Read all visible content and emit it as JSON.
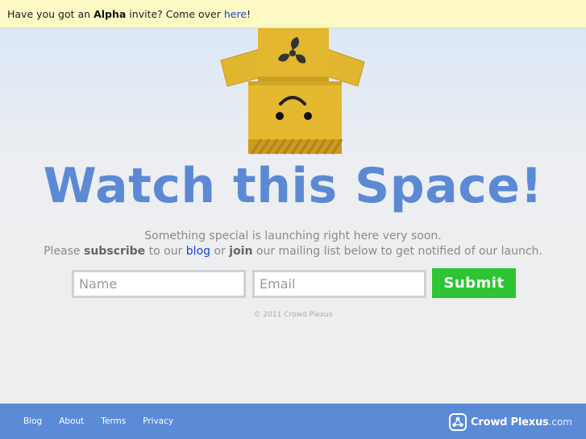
{
  "alpha_bar": {
    "prefix": "Have you got an ",
    "emphasis": "Alpha",
    "middle": " invite? Come over ",
    "link": "here",
    "suffix": "!"
  },
  "hero": {
    "headline": "Watch this Space!",
    "line1": "Something special is launching right here very soon.",
    "line2_a": "Please ",
    "line2_subscribe": "subscribe",
    "line2_b": " to our ",
    "line2_blog": "blog",
    "line2_c": " or ",
    "line2_join": "join",
    "line2_d": " our mailing list below to get notified of our launch."
  },
  "form": {
    "name_placeholder": "Name",
    "email_placeholder": "Email",
    "submit_label": "Submit"
  },
  "copyright": "© 2011 Crowd Plexus",
  "footer": {
    "links": [
      "Blog",
      "About",
      "Terms",
      "Privacy"
    ],
    "brand_name": "Crowd Plexus",
    "brand_tld": ".com"
  },
  "colors": {
    "accent": "#5c89d4",
    "footer": "#5b8ad6",
    "submit": "#2ec433",
    "alpha_bar": "#fdf9c5"
  },
  "icons": [
    "fan-icon",
    "crowd-plexus-logo-icon"
  ]
}
